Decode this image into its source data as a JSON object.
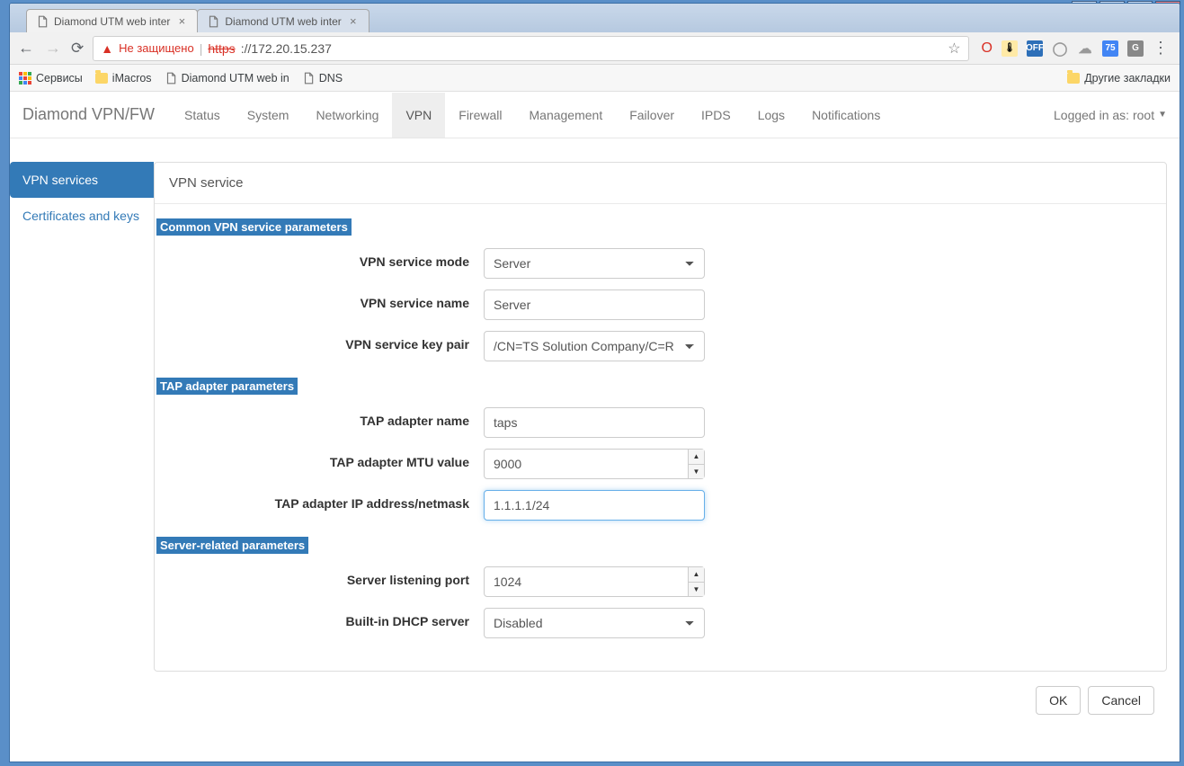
{
  "window": {
    "tabs": [
      {
        "title": "Diamond UTM web inter"
      },
      {
        "title": "Diamond UTM web inter"
      }
    ],
    "address": {
      "not_secure_label": "Не защищено",
      "protocol_strike": "https",
      "rest": "://172.20.15.237"
    }
  },
  "bookmarks": {
    "services_label": "Сервисы",
    "items": [
      "iMacros",
      "Diamond UTM web in",
      "DNS"
    ],
    "other_label": "Другие закладки"
  },
  "appnav": {
    "brand": "Diamond VPN/FW",
    "items": [
      "Status",
      "System",
      "Networking",
      "VPN",
      "Firewall",
      "Management",
      "Failover",
      "IPDS",
      "Logs",
      "Notifications"
    ],
    "active_index": 3,
    "user_label": "Logged in as: root"
  },
  "sidebar": {
    "items": [
      "VPN services",
      "Certificates and keys"
    ],
    "active_index": 0
  },
  "panel": {
    "title": "VPN service",
    "sections": {
      "common": {
        "heading": "Common VPN service parameters",
        "mode_label": "VPN service mode",
        "mode_value": "Server",
        "name_label": "VPN service name",
        "name_value": "Server",
        "keypair_label": "VPN service key pair",
        "keypair_value": "/CN=TS Solution Company/C=R"
      },
      "tap": {
        "heading": "TAP adapter parameters",
        "tapname_label": "TAP adapter name",
        "tapname_value": "taps",
        "mtu_label": "TAP adapter MTU value",
        "mtu_value": "9000",
        "ip_label": "TAP adapter IP address/netmask",
        "ip_value": "1.1.1.1/24"
      },
      "server": {
        "heading": "Server-related parameters",
        "port_label": "Server listening port",
        "port_value": "1024",
        "dhcp_label": "Built-in DHCP server",
        "dhcp_value": "Disabled"
      }
    },
    "buttons": {
      "ok": "OK",
      "cancel": "Cancel"
    }
  }
}
